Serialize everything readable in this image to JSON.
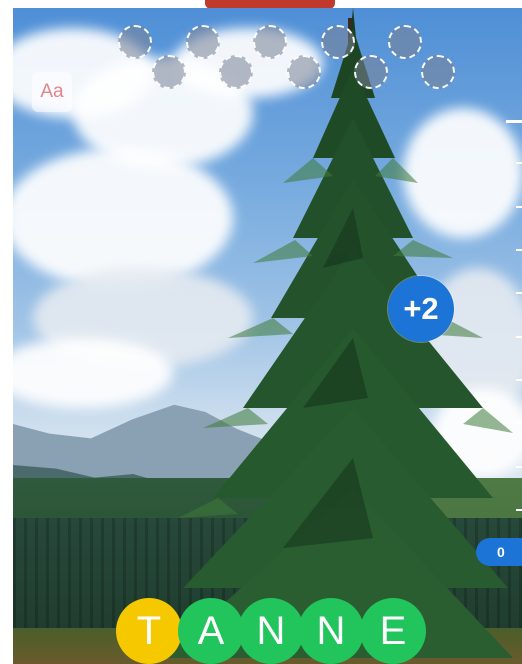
{
  "game": {
    "font_button_label": "Aa",
    "bonus_label": "+2",
    "score": "0",
    "letters": [
      "T",
      "A",
      "N",
      "N",
      "E"
    ],
    "letter_colors": [
      "#f5c800",
      "#22c45c",
      "#22c45c",
      "#22c45c",
      "#22c45c"
    ],
    "empty_slot_count": 11,
    "accent_color": "#1c74d6"
  }
}
